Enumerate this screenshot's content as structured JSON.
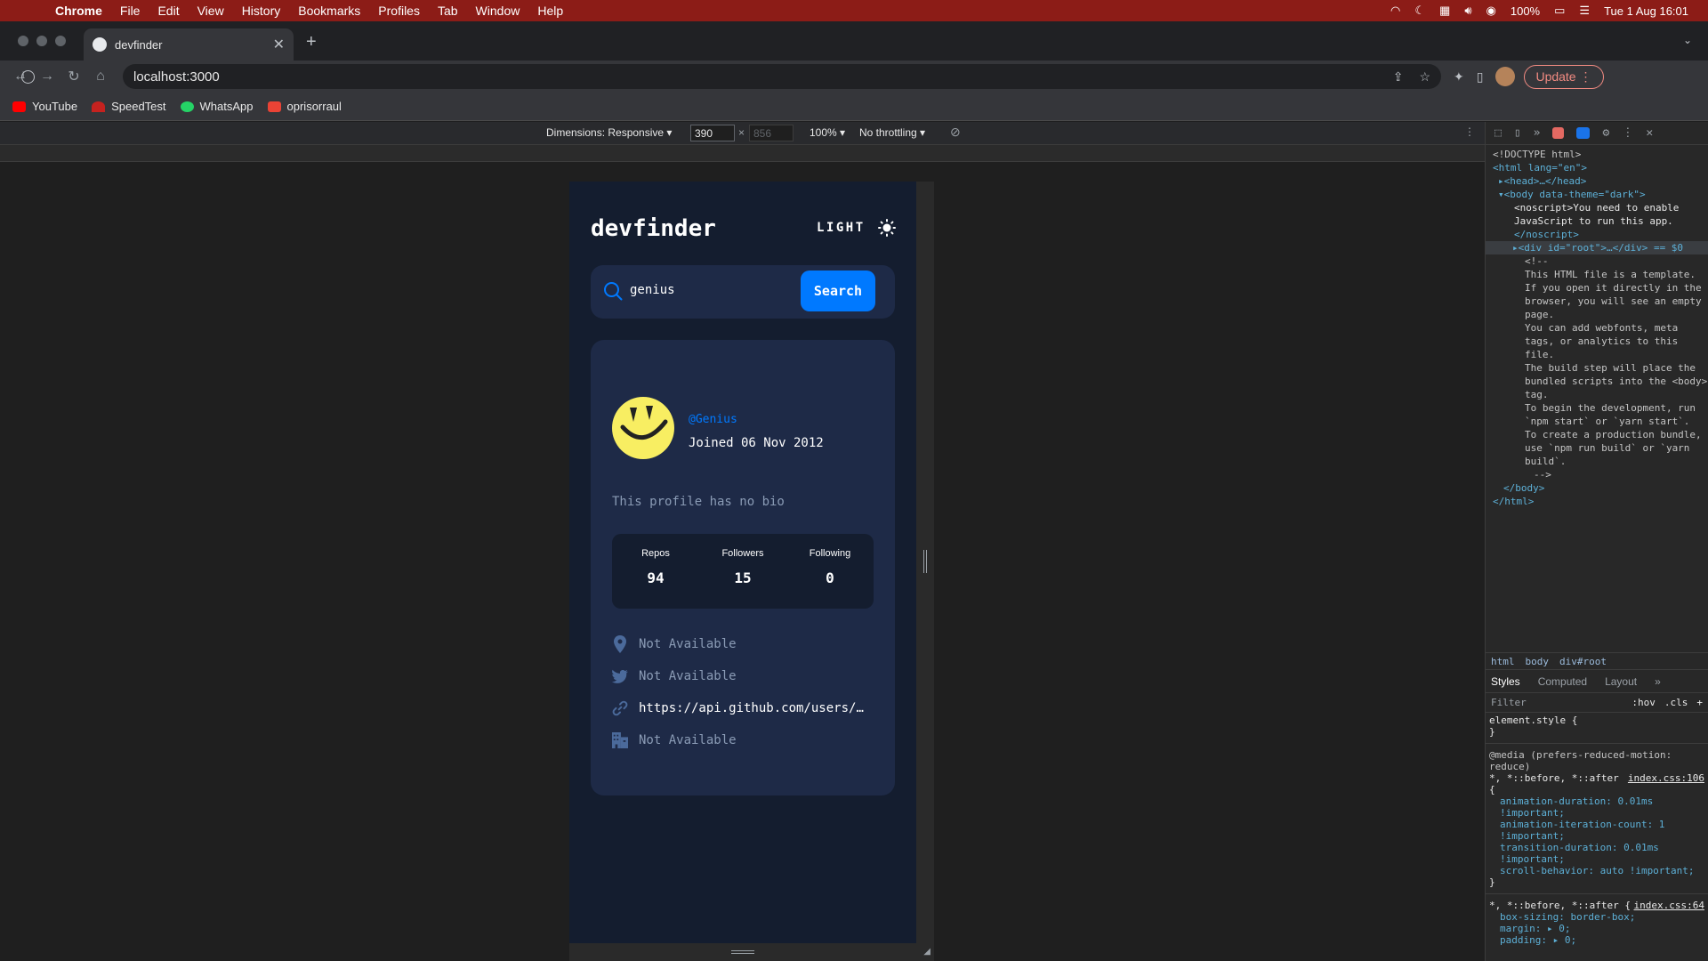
{
  "menubar": {
    "items": [
      "Chrome",
      "File",
      "Edit",
      "View",
      "History",
      "Bookmarks",
      "Profiles",
      "Tab",
      "Window",
      "Help"
    ],
    "battery": "100%",
    "datetime": "Tue 1 Aug  16:01"
  },
  "browser": {
    "tab_title": "devfinder",
    "url": "localhost:3000",
    "update_label": "Update",
    "bookmarks": [
      "YouTube",
      "SpeedTest",
      "WhatsApp",
      "oprisorraul"
    ]
  },
  "devtoolbar": {
    "dimensions": "Dimensions: Responsive ▾",
    "width": "390",
    "height": "856",
    "zoom": "100% ▾",
    "throttling": "No throttling ▾"
  },
  "app": {
    "logo": "devfinder",
    "theme_label": "LIGHT",
    "search_value": "genius",
    "search_button": "Search",
    "profile": {
      "handle": "@Genius",
      "joined": "Joined 06 Nov 2012",
      "bio": "This profile has no bio"
    },
    "stats": [
      {
        "label": "Repos",
        "value": "94"
      },
      {
        "label": "Followers",
        "value": "15"
      },
      {
        "label": "Following",
        "value": "0"
      }
    ],
    "links": {
      "location": "Not Available",
      "twitter": "Not Available",
      "website": "https://api.github.com/users/Genius",
      "company": "Not Available"
    }
  },
  "devtools": {
    "code": [
      "<!DOCTYPE html>",
      "<html lang=\"en\">",
      "▸<head>…</head>",
      "▾<body data-theme=\"dark\">",
      "<noscript>You need to enable JavaScript to run this app.",
      "</noscript>",
      "▸<div id=\"root\">…</div> == $0",
      "<!--",
      "This HTML file is a template.",
      "If you open it directly in the browser, you will see an empty page.",
      "You can add webfonts, meta tags, or analytics to this file.",
      "The build step will place the bundled scripts into the <body> tag.",
      "To begin the development, run `npm start` or `yarn start`.",
      "To create a production bundle, use `npm run build` or `yarn build`.",
      "-->",
      "</body>",
      "</html>"
    ],
    "breadcrumbs": [
      "html",
      "body",
      "div#root"
    ],
    "tabs": [
      "Styles",
      "Computed",
      "Layout",
      "»"
    ],
    "filter_placeholder": "Filter",
    "filter_opts": [
      ":hov",
      ".cls",
      "+"
    ],
    "styles": {
      "element_style": "element.style {",
      "close": "}",
      "media": "@media (prefers-reduced-motion: reduce)",
      "selector1": "*, *::before, *::after {",
      "src1": "index.css:106",
      "decls1": [
        "animation-duration: 0.01ms !important;",
        "animation-iteration-count: 1 !important;",
        "transition-duration: 0.01ms !important;",
        "scroll-behavior: auto !important;"
      ],
      "selector2": "*, *::before, *::after {",
      "src2": "index.css:64",
      "decls2": [
        "box-sizing: border-box;",
        "margin: ▸ 0;",
        "padding: ▸ 0;"
      ]
    }
  }
}
